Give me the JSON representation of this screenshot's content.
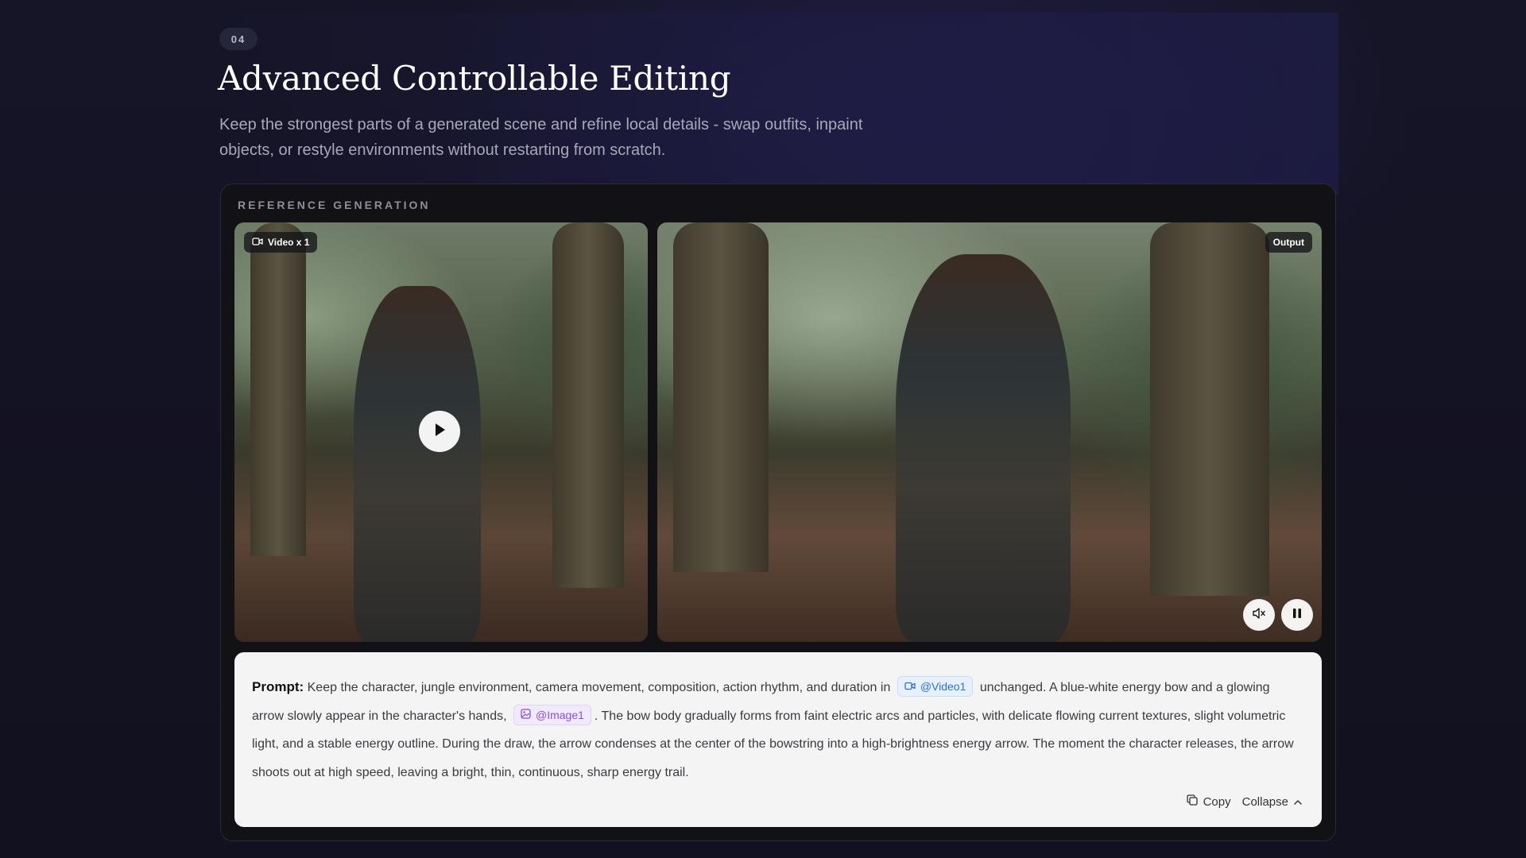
{
  "section": {
    "number": "04",
    "title": "Advanced Controllable Editing",
    "subtitle": "Keep the strongest parts of a generated scene and refine local details - swap outfits, inpaint objects, or restyle environments without restarting from scratch."
  },
  "card": {
    "label": "REFERENCE GENERATION",
    "reference_media": {
      "badge": "Video x 1",
      "badge_icon": "video-camera-icon",
      "control_icon": "play-icon"
    },
    "output_media": {
      "badge": "Output",
      "controls": [
        {
          "icon": "volume-muted-icon"
        },
        {
          "icon": "pause-icon"
        }
      ]
    },
    "prompt": {
      "label": "Prompt:",
      "segment_1": "Keep the character, jungle environment, camera movement, composition, action rhythm, and duration in",
      "video_ref": "@Video1",
      "segment_2": "unchanged. A blue-white energy bow and a glowing arrow slowly appear in the character's hands,",
      "image_ref": "@Image1",
      "segment_3": ". The bow body gradually forms from faint electric arcs and particles, with delicate flowing current textures, slight volumetric light, and a stable energy outline. During the draw, the arrow condenses at the center of the bowstring into a high-brightness energy arrow. The moment the character releases, the arrow shoots out at high speed, leaving a bright, thin, continuous, sharp energy trail."
    },
    "actions": {
      "copy_label": "Copy",
      "collapse_label": "Collapse"
    }
  },
  "colors": {
    "background": "#13121f",
    "card": "#111116",
    "panel": "#f4f4f5",
    "video_chip": "#2f6fd0",
    "image_chip": "#8a4fd6"
  }
}
